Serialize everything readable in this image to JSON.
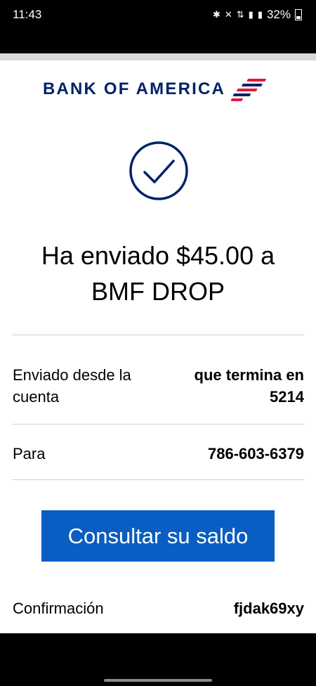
{
  "status_bar": {
    "time": "11:43",
    "icons": [
      "bluetooth-icon",
      "mute-icon",
      "4g-icon",
      "signal-icon",
      "signal-icon"
    ],
    "battery": "32%"
  },
  "logo": {
    "text": "BANK OF AMERICA",
    "brand_color": "#012169",
    "accent_color": "#e31837"
  },
  "confirmation": {
    "headline_line1": "Ha enviado $45.00 a",
    "headline_line2": "BMF DROP",
    "from_label": "Enviado desde la cuenta",
    "from_value": "que termina en 5214",
    "to_label": "Para",
    "to_value": "786-603-6379",
    "button_label": "Consultar su saldo",
    "confirmation_label": "Confirmación",
    "confirmation_value": "fjdak69xy"
  },
  "colors": {
    "button": "#0a5dc2",
    "check": "#012169"
  }
}
